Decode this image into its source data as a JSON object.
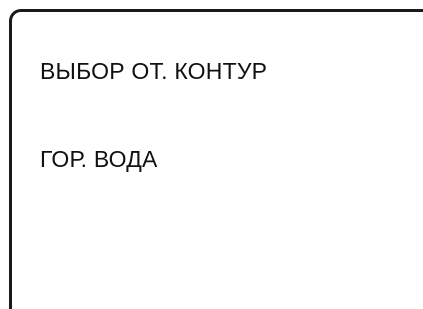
{
  "display": {
    "lines": [
      "ВЫБОР ОТ. КОНТУР",
      "ГОР. ВОДА"
    ]
  }
}
